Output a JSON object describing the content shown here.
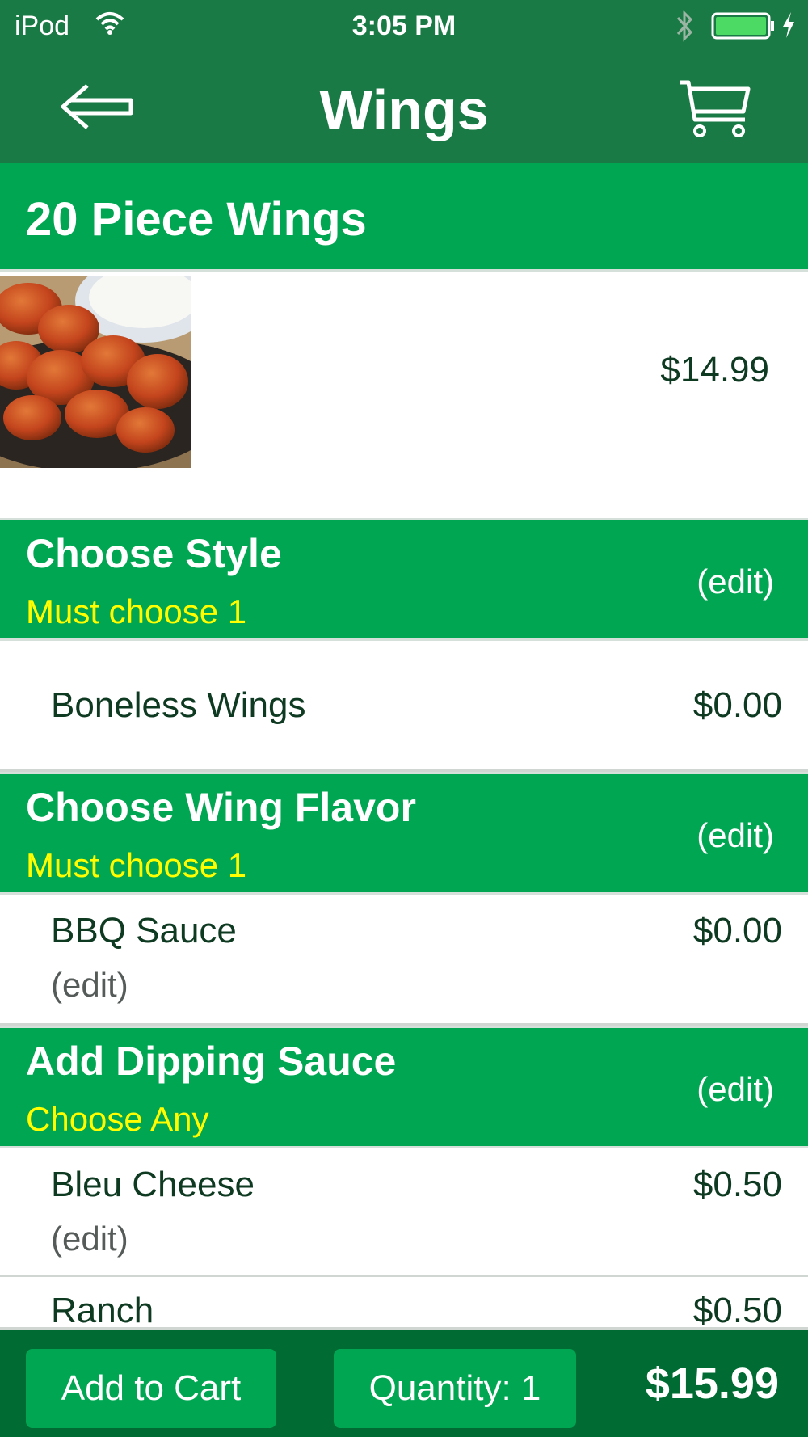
{
  "status_bar": {
    "carrier": "iPod",
    "time": "3:05 PM",
    "icons": [
      "wifi-icon",
      "bluetooth-icon",
      "battery-icon",
      "charging-icon"
    ],
    "battery_level": 1.0
  },
  "nav": {
    "title": "Wings",
    "back_icon": "back-arrow-icon",
    "cart_icon": "cart-icon"
  },
  "item": {
    "name": "20 Piece Wings",
    "price": "$14.99",
    "photo_icon": "boneless-wings-photo"
  },
  "sections": [
    {
      "title": "Choose Style",
      "rule": "Must choose 1",
      "edit": "(edit)",
      "options": [
        {
          "name": "Boneless Wings",
          "price": "$0.00"
        }
      ]
    },
    {
      "title": "Choose Wing Flavor",
      "rule": "Must choose 1",
      "edit": "(edit)",
      "options": [
        {
          "name": "BBQ Sauce",
          "price": "$0.00",
          "edit": "(edit)"
        }
      ]
    },
    {
      "title": "Add Dipping Sauce",
      "rule": "Choose Any",
      "edit": "(edit)",
      "options": [
        {
          "name": "Bleu Cheese",
          "price": "$0.50",
          "edit": "(edit)"
        },
        {
          "name": "Ranch",
          "price": "$0.50"
        }
      ]
    }
  ],
  "footer": {
    "add_to_cart": "Add to Cart",
    "quantity": "Quantity: 1",
    "total": "$15.99"
  },
  "colors": {
    "nav_green": "#1a7a45",
    "section_green": "#00a651",
    "footer_green": "#006b33",
    "rule_yellow": "#ffff00",
    "text_dark": "#0f3a22"
  }
}
